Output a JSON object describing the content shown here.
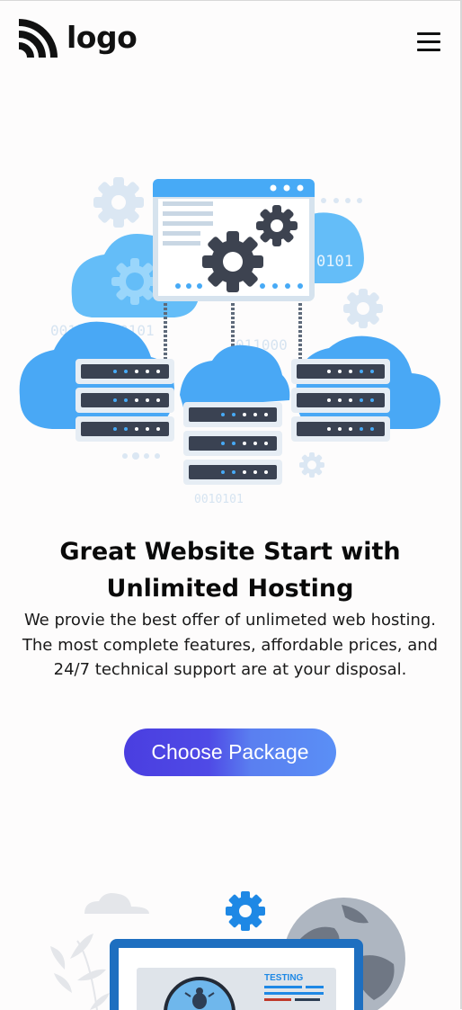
{
  "header": {
    "logo_text": "logo",
    "menu_icon": "hamburger-menu-icon"
  },
  "hero": {
    "illustration_text": {
      "binary_left": "001011000101",
      "binary_right_top": "0101",
      "binary_middle": "011000",
      "binary_bottom": "0010101"
    },
    "title_line1": "Great Website Start with",
    "title_line2": "Unlimited Hosting",
    "description": "We provie the best offer of unlimeted web hosting. The most complete features, affordable prices, and 24/7 technical support are at your disposal.",
    "cta_label": "Choose Package"
  },
  "second_section": {
    "illustration_label": "TESTING"
  },
  "colors": {
    "cloud_blue": "#49a8f5",
    "server_dark": "#3a4252",
    "gear_dark": "#3d4350",
    "button_start": "#4a3ee0",
    "button_end": "#5a8ff6",
    "accent_blue": "#1e88e5"
  }
}
